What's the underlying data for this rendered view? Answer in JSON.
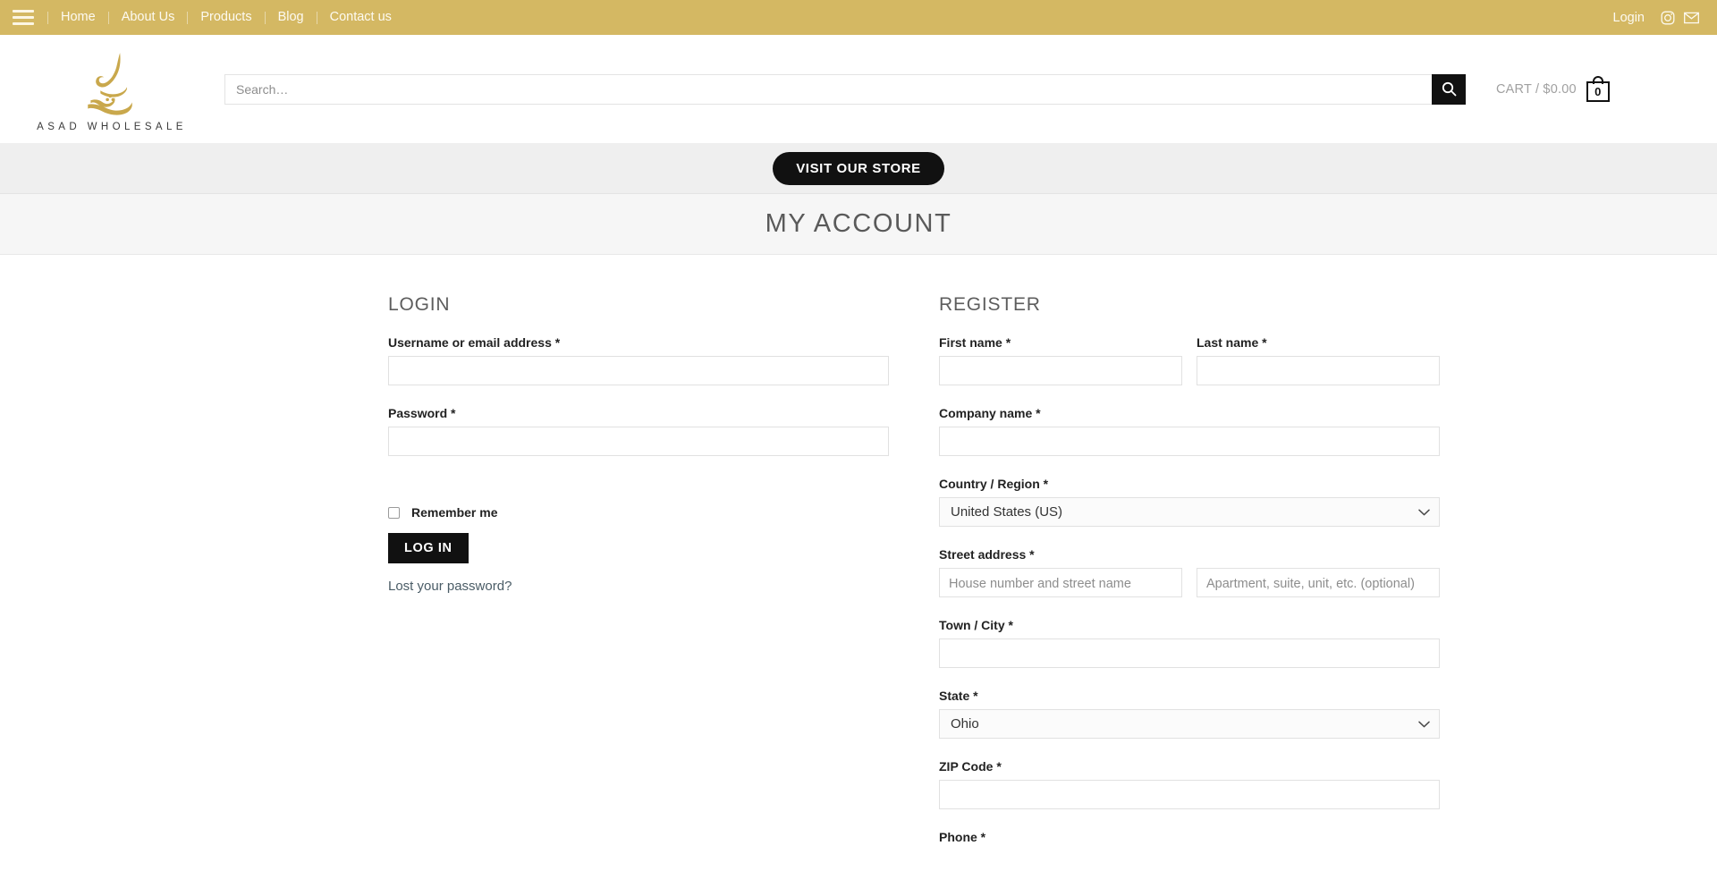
{
  "topbar": {
    "menu_icon": "hamburger-menu-icon",
    "nav": [
      {
        "label": "Home"
      },
      {
        "label": "About Us"
      },
      {
        "label": "Products"
      },
      {
        "label": "Blog"
      },
      {
        "label": "Contact us"
      }
    ],
    "login_label": "Login",
    "social": [
      {
        "name": "instagram-icon"
      },
      {
        "name": "email-icon"
      }
    ],
    "background_color": "#d4b863"
  },
  "header": {
    "logo_text": "ASAD WHOLESALE",
    "search": {
      "placeholder": "Search…",
      "value": "",
      "button_icon": "search-icon"
    },
    "cart": {
      "label": "CART / $0.00",
      "count": "0",
      "icon": "shopping-bag-icon"
    }
  },
  "store_band": {
    "button_label": "VISIT OUR STORE"
  },
  "page": {
    "title": "MY ACCOUNT"
  },
  "login": {
    "heading": "LOGIN",
    "username": {
      "label": "Username or email address",
      "required_mark": "*",
      "value": ""
    },
    "password": {
      "label": "Password",
      "required_mark": "*",
      "value": ""
    },
    "remember_label": "Remember me",
    "remember_checked": false,
    "submit_label": "LOG IN",
    "lost_password_label": "Lost your password?"
  },
  "register": {
    "heading": "REGISTER",
    "first_name": {
      "label": "First name",
      "required_mark": "*",
      "value": ""
    },
    "last_name": {
      "label": "Last name",
      "required_mark": "*",
      "value": ""
    },
    "company": {
      "label": "Company name",
      "required_mark": "*",
      "value": ""
    },
    "country": {
      "label": "Country / Region",
      "required_mark": "*",
      "selected": "United States (US)"
    },
    "street": {
      "label": "Street address",
      "required_mark": "*",
      "line1_placeholder": "House number and street name",
      "line1_value": "",
      "line2_placeholder": "Apartment, suite, unit, etc. (optional)",
      "line2_value": ""
    },
    "city": {
      "label": "Town / City",
      "required_mark": "*",
      "value": ""
    },
    "state": {
      "label": "State",
      "required_mark": "*",
      "selected": "Ohio"
    },
    "zip": {
      "label": "ZIP Code",
      "required_mark": "*",
      "value": ""
    },
    "phone": {
      "label": "Phone",
      "required_mark": "*"
    }
  }
}
